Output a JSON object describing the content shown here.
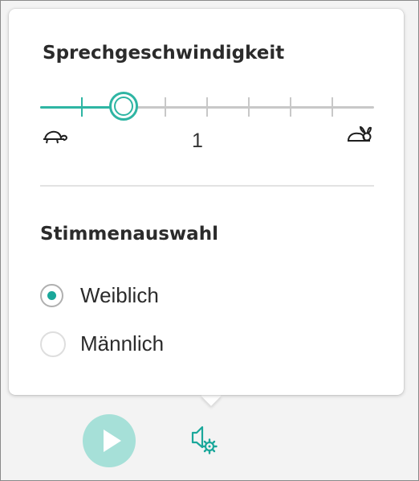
{
  "speed": {
    "title": "Sprechgeschwindigkeit",
    "value": "1",
    "level_fraction": 0.25,
    "tick_count": 8,
    "slow_icon": "turtle-icon",
    "fast_icon": "rabbit-icon"
  },
  "voice": {
    "title": "Stimmenauswahl",
    "options": [
      {
        "label": "Weiblich",
        "selected": true
      },
      {
        "label": "Männlich",
        "selected": false
      }
    ]
  },
  "toolbar": {
    "play_icon": "play-icon",
    "speaker_settings_icon": "speaker-settings-icon"
  },
  "colors": {
    "accent": "#2eb5a3",
    "play_background": "#a6e0d8",
    "radio_dot": "#1aa79a"
  }
}
